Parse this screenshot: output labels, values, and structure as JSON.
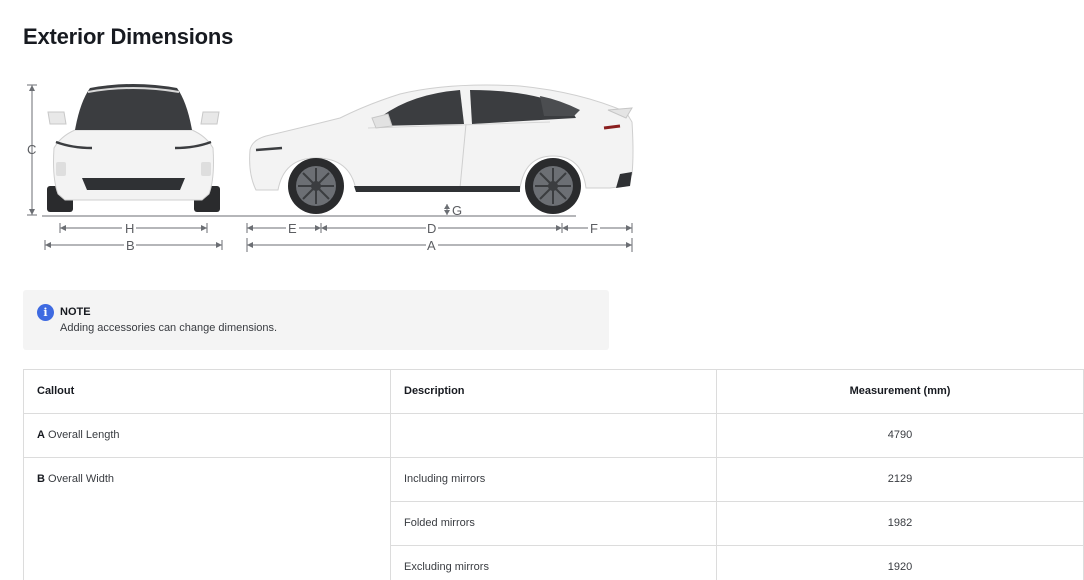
{
  "page": {
    "title": "Exterior Dimensions"
  },
  "diagram": {
    "labels": {
      "A": "A",
      "B": "B",
      "C": "C",
      "D": "D",
      "E": "E",
      "F": "F",
      "G": "G",
      "H": "H"
    },
    "colors": {
      "car_body": "#f2f2f2",
      "dimension_line": "#6b6e73",
      "window": "#3b3d40",
      "tire": "#2a2b2d"
    }
  },
  "note": {
    "icon": "info-icon",
    "icon_glyph": "i",
    "title": "NOTE",
    "text": "Adding accessories can change dimensions."
  },
  "table": {
    "headers": {
      "callout": "Callout",
      "description": "Description",
      "measurement": "Measurement (mm)"
    },
    "rows": [
      {
        "letter": "A",
        "name": " Overall Length",
        "description": "",
        "measurement": "4790"
      },
      {
        "letter": "B",
        "name": " Overall Width",
        "description": "Including mirrors",
        "measurement": "2129"
      },
      {
        "letter": "",
        "name": "",
        "description": "Folded mirrors",
        "measurement": "1982"
      },
      {
        "letter": "",
        "name": "",
        "description": "Excluding mirrors",
        "measurement": "1920"
      }
    ]
  }
}
